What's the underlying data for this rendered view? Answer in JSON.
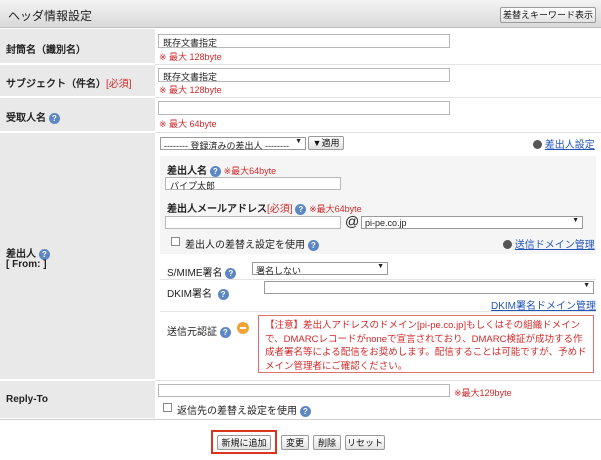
{
  "header": {
    "title": "ヘッダ情報設定",
    "keyword_button": "差替えキーワード表示"
  },
  "fields": {
    "subject_name": {
      "label": "封筒名（識別名）",
      "value": "既存文書指定",
      "note": "※ 最大 128byte"
    },
    "subject": {
      "label": "サブジェクト（件名）",
      "required": "[必須]",
      "value": "既存文書指定",
      "note": "※ 最大 128byte"
    },
    "recipient": {
      "label": "受取人名",
      "value": "",
      "note": "※ 最大 64byte"
    },
    "sender": {
      "label": "差出人",
      "label_sub": "[ From: ]",
      "preset_select": "-------- 登録済みの差出人 --------",
      "apply_button": "▼適用",
      "settings_link": "差出人設定",
      "name_label": "差出人名",
      "name_note": "※最大64byte",
      "name_value": "パイプ太郎",
      "address_label": "差出人メールアドレス",
      "address_required": "[必須]",
      "address_note": "※最大64byte",
      "address_local": "",
      "at": "@",
      "domain_select": "pi-pe.co.jp",
      "replace_checkbox": "差出人の差替え設定を使用",
      "domain_link": "送信ドメイン管理",
      "smime_label": "S/MIME署名",
      "smime_select": "署名しない",
      "dkim_label": "DKIM署名",
      "dkim_select": "",
      "dkim_link": "DKIM署名ドメイン管理",
      "auth_label": "送信元認証",
      "auth_notice": "【注意】差出人アドレスのドメイン[pi-pe.co.jp]もしくはその組織ドメインで、DMARCレコードがnoneで宣言されており、DMARC検証が成功する作成者署名等による配信をお奨めします。配信することは可能ですが、予めドメイン管理者にご確認ください。"
    },
    "reply_to": {
      "label": "Reply-To",
      "value": "",
      "note": "※最大129byte",
      "replace_checkbox": "返信先の差替え設定を使用"
    }
  },
  "actions": {
    "new": "新規に追加",
    "update": "変更",
    "delete": "削除",
    "reset": "リセット"
  },
  "colors": {
    "required": "#d12a2a",
    "link": "#2355b8",
    "highlight": "#d9351f",
    "help": "#5c87c4"
  }
}
